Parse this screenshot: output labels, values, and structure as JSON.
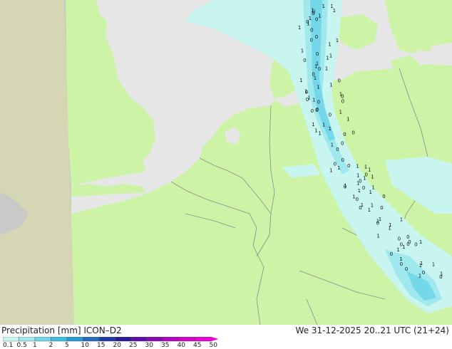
{
  "footer": {
    "legend_title": "Precipitation [mm]  ICON–D2",
    "valid_time": "We 31-12-2025 20..21 UTC (21+24)"
  },
  "colorbar": {
    "labels": [
      "0.1",
      "0.5",
      "1",
      "2",
      "5",
      "10",
      "15",
      "20",
      "25",
      "30",
      "35",
      "40",
      "45",
      "50"
    ],
    "colors": [
      "#c8f5f0",
      "#a0e8ee",
      "#6fd6e8",
      "#3cbde0",
      "#2a9ad2",
      "#2468c0",
      "#1f3aa8",
      "#2a1a9a",
      "#5a10a8",
      "#8a08b4",
      "#b400c0",
      "#d400c8",
      "#ee00d4"
    ]
  },
  "map": {
    "colors": {
      "land": "#cdf4a6",
      "sea": "#e6e6e6",
      "outside_domain": "#c9c9c9",
      "outside_land": "#d4d6b4",
      "border": "#8a8a8a",
      "precip_light": "#c8f5f0",
      "precip_medium": "#9ee8ee",
      "precip_core": "#74d8ea"
    }
  }
}
